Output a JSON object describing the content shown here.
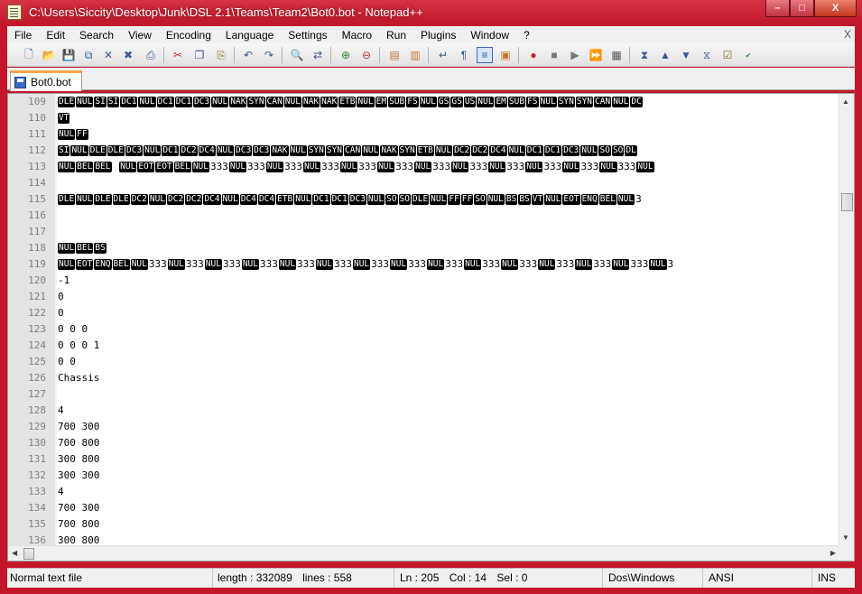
{
  "window": {
    "title": "C:\\Users\\Siccity\\Desktop\\Junk\\DSL 2.1\\Teams\\Team2\\Bot0.bot - Notepad++",
    "minimize_label": "–",
    "maximize_label": "□",
    "close_label": "X"
  },
  "menu": {
    "items": [
      "File",
      "Edit",
      "Search",
      "View",
      "Encoding",
      "Language",
      "Settings",
      "Macro",
      "Run",
      "Plugins",
      "Window",
      "?"
    ],
    "close_doc": "X"
  },
  "tabs": [
    {
      "label": "Bot0.bot"
    }
  ],
  "editor": {
    "lines": [
      {
        "num": "109",
        "tokens": [
          [
            "c",
            "DLE"
          ],
          [
            "c",
            "NUL"
          ],
          [
            "c",
            "SI"
          ],
          [
            "c",
            "SI"
          ],
          [
            "c",
            "DC1"
          ],
          [
            "c",
            "NUL"
          ],
          [
            "c",
            "DC1"
          ],
          [
            "c",
            "DC1"
          ],
          [
            "c",
            "DC3"
          ],
          [
            "c",
            "NUL"
          ],
          [
            "c",
            "NAK"
          ],
          [
            "c",
            "SYN"
          ],
          [
            "c",
            "CAN"
          ],
          [
            "c",
            "NUL"
          ],
          [
            "c",
            "NAK"
          ],
          [
            "c",
            "NAK"
          ],
          [
            "c",
            "ETB"
          ],
          [
            "c",
            "NUL"
          ],
          [
            "c",
            "EM"
          ],
          [
            "c",
            "SUB"
          ],
          [
            "c",
            "FS"
          ],
          [
            "c",
            "NUL"
          ],
          [
            "c",
            "GS"
          ],
          [
            "c",
            "GS"
          ],
          [
            "c",
            "US"
          ],
          [
            "c",
            "NUL"
          ],
          [
            "c",
            "EM"
          ],
          [
            "c",
            "SUB"
          ],
          [
            "c",
            "FS"
          ],
          [
            "c",
            "NUL"
          ],
          [
            "c",
            "SYN"
          ],
          [
            "c",
            "SYN"
          ],
          [
            "c",
            "CAN"
          ],
          [
            "c",
            "NUL"
          ],
          [
            "c",
            "DC"
          ]
        ]
      },
      {
        "num": "110",
        "tokens": [
          [
            "c",
            "VT"
          ]
        ]
      },
      {
        "num": "111",
        "tokens": [
          [
            "c",
            "NUL"
          ],
          [
            "c",
            "FF"
          ]
        ]
      },
      {
        "num": "112",
        "tokens": [
          [
            "c",
            "SI"
          ],
          [
            "c",
            "NUL"
          ],
          [
            "c",
            "DLE"
          ],
          [
            "c",
            "DLE"
          ],
          [
            "c",
            "DC3"
          ],
          [
            "c",
            "NUL"
          ],
          [
            "c",
            "DC1"
          ],
          [
            "c",
            "DC2"
          ],
          [
            "c",
            "DC4"
          ],
          [
            "c",
            "NUL"
          ],
          [
            "c",
            "DC3"
          ],
          [
            "c",
            "DC3"
          ],
          [
            "c",
            "NAK"
          ],
          [
            "c",
            "NUL"
          ],
          [
            "c",
            "SYN"
          ],
          [
            "c",
            "SYN"
          ],
          [
            "c",
            "CAN"
          ],
          [
            "c",
            "NUL"
          ],
          [
            "c",
            "NAK"
          ],
          [
            "c",
            "SYN"
          ],
          [
            "c",
            "ETB"
          ],
          [
            "c",
            "NUL"
          ],
          [
            "c",
            "DC2"
          ],
          [
            "c",
            "DC2"
          ],
          [
            "c",
            "DC4"
          ],
          [
            "c",
            "NUL"
          ],
          [
            "c",
            "DC1"
          ],
          [
            "c",
            "DC1"
          ],
          [
            "c",
            "DC3"
          ],
          [
            "c",
            "NUL"
          ],
          [
            "c",
            "SO"
          ],
          [
            "c",
            "SO"
          ],
          [
            "c",
            "DL"
          ]
        ]
      },
      {
        "num": "113",
        "tokens": [
          [
            "c",
            "NUL"
          ],
          [
            "c",
            "BEL"
          ],
          [
            "c",
            "BEL"
          ],
          [
            "t",
            "  "
          ],
          [
            "c",
            "NUL"
          ],
          [
            "c",
            "EOT"
          ],
          [
            "c",
            "EOT"
          ],
          [
            "c",
            "BEL"
          ],
          [
            "c",
            "NUL"
          ],
          [
            "t",
            "333"
          ],
          [
            "c",
            "NUL"
          ],
          [
            "t",
            "333"
          ],
          [
            "c",
            "NUL"
          ],
          [
            "t",
            "333"
          ],
          [
            "c",
            "NUL"
          ],
          [
            "t",
            "333"
          ],
          [
            "c",
            "NUL"
          ],
          [
            "t",
            "333"
          ],
          [
            "c",
            "NUL"
          ],
          [
            "t",
            "333"
          ],
          [
            "c",
            "NUL"
          ],
          [
            "t",
            "333"
          ],
          [
            "c",
            "NUL"
          ],
          [
            "t",
            "333"
          ],
          [
            "c",
            "NUL"
          ],
          [
            "t",
            "333"
          ],
          [
            "c",
            "NUL"
          ],
          [
            "t",
            "333"
          ],
          [
            "c",
            "NUL"
          ],
          [
            "t",
            "333"
          ],
          [
            "c",
            "NUL"
          ],
          [
            "t",
            "333"
          ],
          [
            "c",
            "NUL"
          ]
        ]
      },
      {
        "num": "114",
        "tokens": []
      },
      {
        "num": "115",
        "tokens": [
          [
            "c",
            "DLE"
          ],
          [
            "c",
            "NUL"
          ],
          [
            "c",
            "DLE"
          ],
          [
            "c",
            "DLE"
          ],
          [
            "c",
            "DC2"
          ],
          [
            "c",
            "NUL"
          ],
          [
            "c",
            "DC2"
          ],
          [
            "c",
            "DC2"
          ],
          [
            "c",
            "DC4"
          ],
          [
            "c",
            "NUL"
          ],
          [
            "c",
            "DC4"
          ],
          [
            "c",
            "DC4"
          ],
          [
            "c",
            "ETB"
          ],
          [
            "c",
            "NUL"
          ],
          [
            "c",
            "DC1"
          ],
          [
            "c",
            "DC1"
          ],
          [
            "c",
            "DC3"
          ],
          [
            "c",
            "NUL"
          ],
          [
            "c",
            "SO"
          ],
          [
            "c",
            "SO"
          ],
          [
            "c",
            "DLE"
          ],
          [
            "c",
            "NUL"
          ],
          [
            "c",
            "FF"
          ],
          [
            "c",
            "FF"
          ],
          [
            "c",
            "SO"
          ],
          [
            "c",
            "NUL"
          ],
          [
            "c",
            "BS"
          ],
          [
            "c",
            "BS"
          ],
          [
            "c",
            "VT"
          ],
          [
            "c",
            "NUL"
          ],
          [
            "c",
            "EOT"
          ],
          [
            "c",
            "ENQ"
          ],
          [
            "c",
            "BEL"
          ],
          [
            "c",
            "NUL"
          ],
          [
            "t",
            "3"
          ]
        ]
      },
      {
        "num": "116",
        "tokens": []
      },
      {
        "num": "117",
        "tokens": []
      },
      {
        "num": "118",
        "tokens": [
          [
            "c",
            "NUL"
          ],
          [
            "c",
            "BEL"
          ],
          [
            "c",
            "BS"
          ]
        ]
      },
      {
        "num": "119",
        "tokens": [
          [
            "c",
            "NUL"
          ],
          [
            "c",
            "EOT"
          ],
          [
            "c",
            "ENQ"
          ],
          [
            "c",
            "BEL"
          ],
          [
            "c",
            "NUL"
          ],
          [
            "t",
            "333"
          ],
          [
            "c",
            "NUL"
          ],
          [
            "t",
            "333"
          ],
          [
            "c",
            "NUL"
          ],
          [
            "t",
            "333"
          ],
          [
            "c",
            "NUL"
          ],
          [
            "t",
            "333"
          ],
          [
            "c",
            "NUL"
          ],
          [
            "t",
            "333"
          ],
          [
            "c",
            "NUL"
          ],
          [
            "t",
            "333"
          ],
          [
            "c",
            "NUL"
          ],
          [
            "t",
            "333"
          ],
          [
            "c",
            "NUL"
          ],
          [
            "t",
            "333"
          ],
          [
            "c",
            "NUL"
          ],
          [
            "t",
            "333"
          ],
          [
            "c",
            "NUL"
          ],
          [
            "t",
            "333"
          ],
          [
            "c",
            "NUL"
          ],
          [
            "t",
            "333"
          ],
          [
            "c",
            "NUL"
          ],
          [
            "t",
            "333"
          ],
          [
            "c",
            "NUL"
          ],
          [
            "t",
            "333"
          ],
          [
            "c",
            "NUL"
          ],
          [
            "t",
            "333"
          ],
          [
            "c",
            "NUL"
          ],
          [
            "t",
            "3"
          ]
        ]
      },
      {
        "num": "120",
        "tokens": [
          [
            "t",
            "-1"
          ]
        ]
      },
      {
        "num": "121",
        "tokens": [
          [
            "t",
            "0"
          ]
        ]
      },
      {
        "num": "122",
        "tokens": [
          [
            "t",
            "0"
          ]
        ]
      },
      {
        "num": "123",
        "tokens": [
          [
            "t",
            "0 0 0"
          ]
        ]
      },
      {
        "num": "124",
        "tokens": [
          [
            "t",
            "0 0 0 1"
          ]
        ]
      },
      {
        "num": "125",
        "tokens": [
          [
            "t",
            "0 0"
          ]
        ]
      },
      {
        "num": "126",
        "tokens": [
          [
            "t",
            "Chassis"
          ]
        ]
      },
      {
        "num": "127",
        "tokens": []
      },
      {
        "num": "128",
        "tokens": [
          [
            "t",
            "4"
          ]
        ]
      },
      {
        "num": "129",
        "tokens": [
          [
            "t",
            "700 300"
          ]
        ]
      },
      {
        "num": "130",
        "tokens": [
          [
            "t",
            "700 800"
          ]
        ]
      },
      {
        "num": "131",
        "tokens": [
          [
            "t",
            "300 800"
          ]
        ]
      },
      {
        "num": "132",
        "tokens": [
          [
            "t",
            "300 300"
          ]
        ]
      },
      {
        "num": "133",
        "tokens": [
          [
            "t",
            "4"
          ]
        ]
      },
      {
        "num": "134",
        "tokens": [
          [
            "t",
            "700 300"
          ]
        ]
      },
      {
        "num": "135",
        "tokens": [
          [
            "t",
            "700 800"
          ]
        ]
      },
      {
        "num": "136",
        "tokens": [
          [
            "t",
            "300 800"
          ]
        ]
      }
    ]
  },
  "statusbar": {
    "filetype": "Normal text file",
    "length": "length : 332089",
    "lines": "lines : 558",
    "ln": "Ln : 205",
    "col": "Col : 14",
    "sel": "Sel : 0",
    "eol": "Dos\\Windows",
    "encoding": "ANSI",
    "mode": "INS"
  },
  "toolbar_icons": [
    "new-file-icon",
    "open-file-icon",
    "save-icon",
    "save-all-icon",
    "close-icon",
    "close-all-icon",
    "print-icon",
    "cut-icon",
    "copy-icon",
    "paste-icon",
    "undo-icon",
    "redo-icon",
    "find-icon",
    "replace-icon",
    "zoom-in-icon",
    "zoom-out-icon",
    "sync-vertical-icon",
    "sync-horizontal-icon",
    "word-wrap-icon",
    "show-all-chars-icon",
    "indent-guide-icon",
    "user-lang-icon",
    "record-macro-icon",
    "stop-record-icon",
    "play-macro-icon",
    "run-macro-multiple-icon",
    "save-macro-icon",
    "collapse-icon",
    "prev-icon",
    "next-icon",
    "expand-icon",
    "spell-check-icon",
    "abc-check-icon"
  ]
}
